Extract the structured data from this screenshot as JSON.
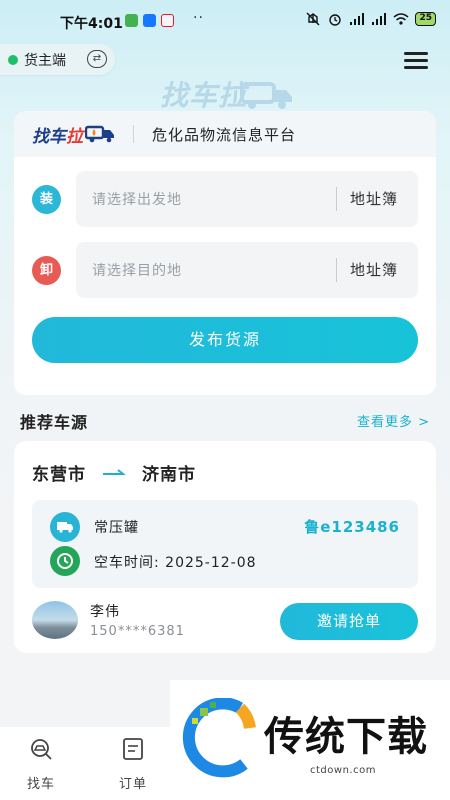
{
  "status_bar": {
    "time": "下午4:01",
    "dots": "··",
    "battery": "25"
  },
  "header": {
    "role_label": "货主端",
    "role_switch_icon": "swap-icon",
    "menu_icon": "hamburger-icon",
    "watermark_logo": "找车拉"
  },
  "brand": {
    "logo_text_a": "找车",
    "logo_text_b": "拉",
    "slogan": "危化品物流信息平台"
  },
  "form": {
    "load_badge": "装",
    "unload_badge": "卸",
    "from_placeholder": "请选择出发地",
    "to_placeholder": "请选择目的地",
    "address_book": "地址簿",
    "publish_button": "发布货源"
  },
  "recommend": {
    "title": "推荐车源",
    "more": "查看更多 >",
    "item": {
      "from": "东营市",
      "to": "济南市",
      "vehicle_type": "常压罐",
      "plate": "鲁e123486",
      "empty_time": "空车时间: 2025-12-08",
      "name": "李伟",
      "phone": "150****6381",
      "invite_button": "邀请抢单"
    }
  },
  "tabbar": {
    "tabs": [
      {
        "label": "找车",
        "icon": "car-search-icon"
      },
      {
        "label": "订单",
        "icon": "order-list-icon"
      }
    ]
  },
  "ad": {
    "title": "传统下载",
    "url": "ctdown.com"
  },
  "colors": {
    "accent": "#19b2d0",
    "load": "#2cb6d8",
    "unload": "#e85a54",
    "clock": "#23a55a"
  }
}
